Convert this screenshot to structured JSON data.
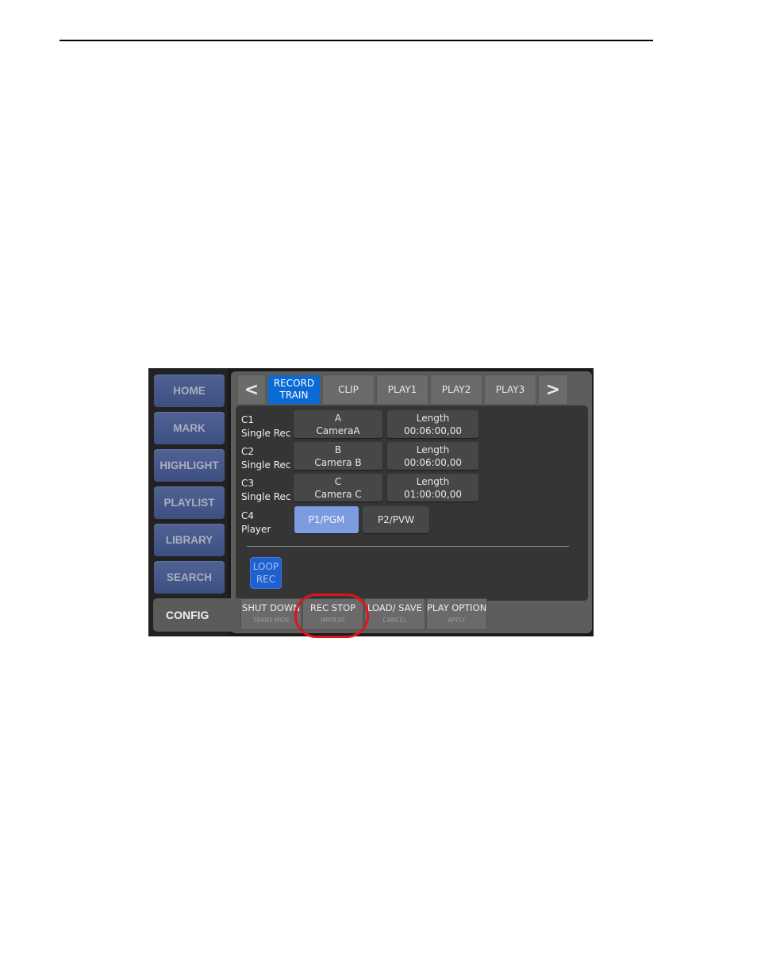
{
  "sidebar": {
    "items": [
      {
        "label": "HOME"
      },
      {
        "label": "MARK"
      },
      {
        "label": "HIGHLIGHT"
      },
      {
        "label": "PLAYLIST"
      },
      {
        "label": "LIBRARY"
      },
      {
        "label": "SEARCH"
      }
    ],
    "config_label": "CONFIG"
  },
  "tabs": {
    "prev_icon": "<",
    "next_icon": ">",
    "items": [
      {
        "label": "RECORD TRAIN",
        "active": true
      },
      {
        "label": "CLIP"
      },
      {
        "label": "PLAY1"
      },
      {
        "label": "PLAY2"
      },
      {
        "label": "PLAY3"
      }
    ]
  },
  "channels": [
    {
      "id": "C1",
      "mode": "Single Rec",
      "source_letter": "A",
      "source_name": "CameraA",
      "length_label": "Length",
      "length_value": "00:06:00,00"
    },
    {
      "id": "C2",
      "mode": "Single Rec",
      "source_letter": "B",
      "source_name": "Camera B",
      "length_label": "Length",
      "length_value": "00:06:00,00"
    },
    {
      "id": "C3",
      "mode": "Single Rec",
      "source_letter": "C",
      "source_name": "Camera C",
      "length_label": "Length",
      "length_value": "01:00:00,00"
    },
    {
      "id": "C4",
      "mode": "Player",
      "options": [
        "P1/PGM",
        "P2/PVW"
      ],
      "selected": "P1/PGM"
    }
  ],
  "loop_rec": {
    "line1": "LOOP",
    "line2": "REC"
  },
  "bottom_bar": [
    {
      "label": "SHUT DOWN",
      "sub": "TRANS MON"
    },
    {
      "label": "REC STOP",
      "sub": "IMP/EXP",
      "highlighted": true
    },
    {
      "label": "LOAD/ SAVE",
      "sub": "CANCEL"
    },
    {
      "label": "PLAY OPTION",
      "sub": "APPLY"
    }
  ],
  "colors": {
    "active_tab": "#0a6ad6",
    "sidebar_button": "#4a5c8c",
    "selected_option": "#7b9cde",
    "highlight_ring": "#e0141a"
  }
}
